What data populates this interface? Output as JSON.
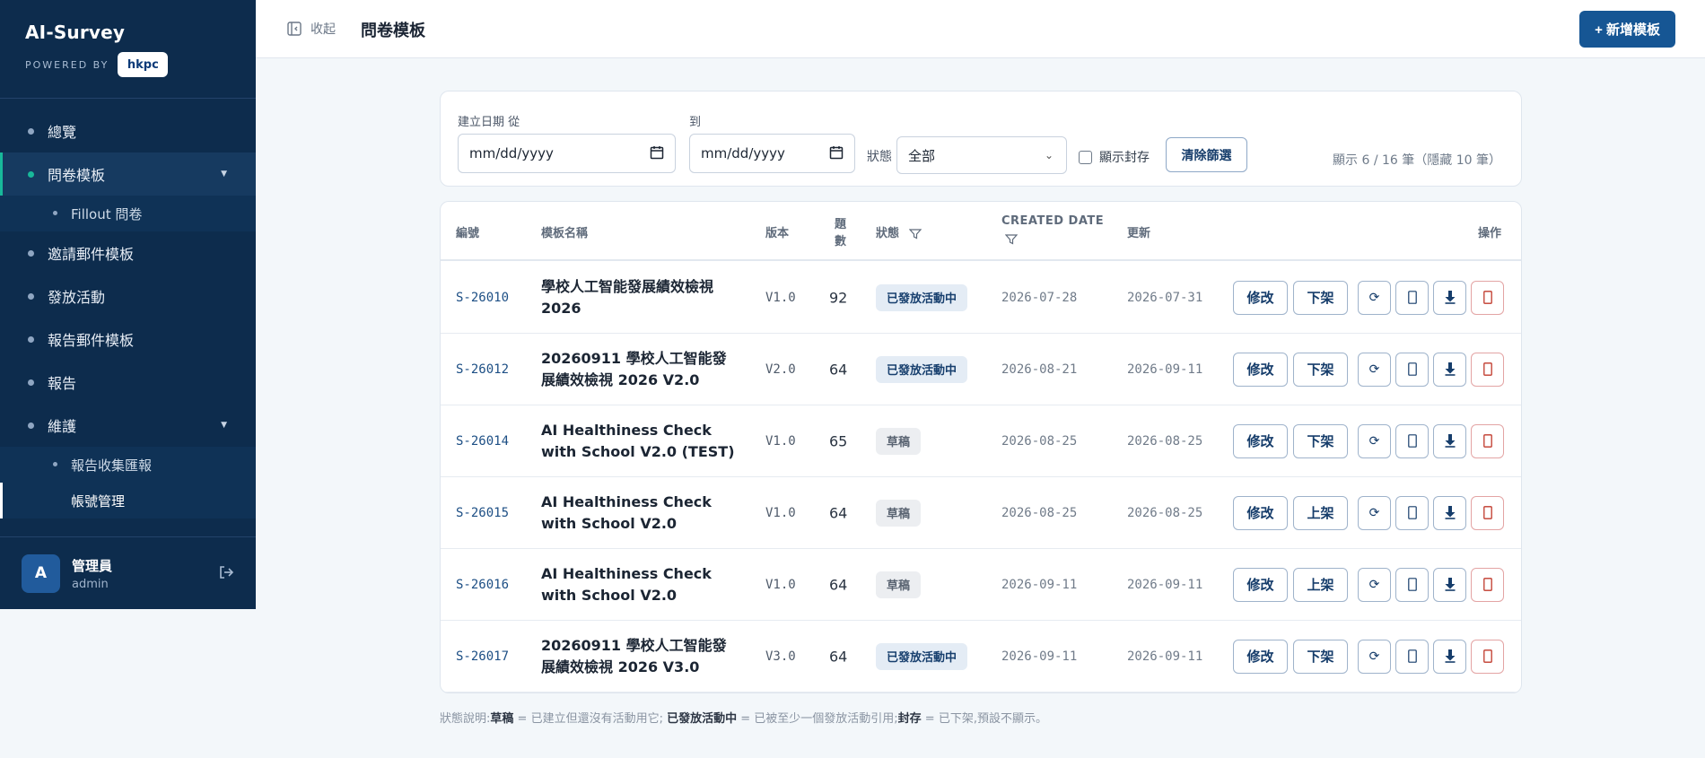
{
  "brand": {
    "title": "AI-Survey",
    "powered_by": "POWERED BY",
    "logo": "hkpc"
  },
  "nav": {
    "overview": "總覽",
    "templates": "問卷模板",
    "fillout": "Fillout 問卷",
    "invite_mail": "邀請郵件模板",
    "campaigns": "發放活動",
    "report_mail": "報告郵件模板",
    "reports": "報告",
    "maintenance": "維護",
    "report_collect": "報告收集匯報",
    "accounts": "帳號管理"
  },
  "user": {
    "initial": "A",
    "name": "管理員",
    "role": "admin"
  },
  "topbar": {
    "collapse": "收起",
    "title": "問卷模板",
    "new_button": "+ 新增模板"
  },
  "filters": {
    "from_label": "建立日期 從",
    "to_label": "到",
    "date_placeholder": "mm/dd/yyyy",
    "status_label": "狀態",
    "status_value": "全部",
    "show_archived": "顯示封存",
    "clear": "清除篩選",
    "count": "顯示 6 / 16 筆（隱藏 10 筆）"
  },
  "table": {
    "headers": {
      "code": "編號",
      "name": "模板名稱",
      "version": "版本",
      "questions_line1": "題",
      "questions_line2": "數",
      "status": "狀態",
      "created": "CREATED DATE",
      "updated": "更新",
      "actions": "操作"
    },
    "edit_label": "修改",
    "rows": [
      {
        "code": "S-26010",
        "name": "學校人工智能發展績效檢視 2026",
        "version": "V1.0",
        "questions": "92",
        "status": "已發放活動中",
        "status_type": "active",
        "created": "2026-07-28",
        "updated": "2026-07-31",
        "toggle": "下架"
      },
      {
        "code": "S-26012",
        "name": "20260911 學校人工智能發展績效檢視 2026 V2.0",
        "version": "V2.0",
        "questions": "64",
        "status": "已發放活動中",
        "status_type": "active",
        "created": "2026-08-21",
        "updated": "2026-09-11",
        "toggle": "下架"
      },
      {
        "code": "S-26014",
        "name": "AI Healthiness Check with School V2.0 (TEST)",
        "version": "V1.0",
        "questions": "65",
        "status": "草稿",
        "status_type": "draft",
        "created": "2026-08-25",
        "updated": "2026-08-25",
        "toggle": "下架"
      },
      {
        "code": "S-26015",
        "name": "AI Healthiness Check with School V2.0",
        "version": "V1.0",
        "questions": "64",
        "status": "草稿",
        "status_type": "draft",
        "created": "2026-08-25",
        "updated": "2026-08-25",
        "toggle": "上架"
      },
      {
        "code": "S-26016",
        "name": "AI Healthiness Check with School V2.0",
        "version": "V1.0",
        "questions": "64",
        "status": "草稿",
        "status_type": "draft",
        "created": "2026-09-11",
        "updated": "2026-09-11",
        "toggle": "上架"
      },
      {
        "code": "S-26017",
        "name": "20260911 學校人工智能發展績效檢視 2026 V3.0",
        "version": "V3.0",
        "questions": "64",
        "status": "已發放活動中",
        "status_type": "active",
        "created": "2026-09-11",
        "updated": "2026-09-11",
        "toggle": "下架"
      }
    ]
  },
  "legend": {
    "prefix": "狀態說明:",
    "draft": "草稿",
    "draft_desc": " = 已建立但還沒有活動用它; ",
    "active": "已發放活動中",
    "active_desc": " = 已被至少一個發放活動引用;",
    "archived": "封存",
    "archived_desc": " = 已下架,預設不顯示。"
  },
  "colors": {
    "sidebar": "#0d2c4d",
    "accent": "#18b89a",
    "primary": "#165694",
    "danger": "#c0392b"
  }
}
